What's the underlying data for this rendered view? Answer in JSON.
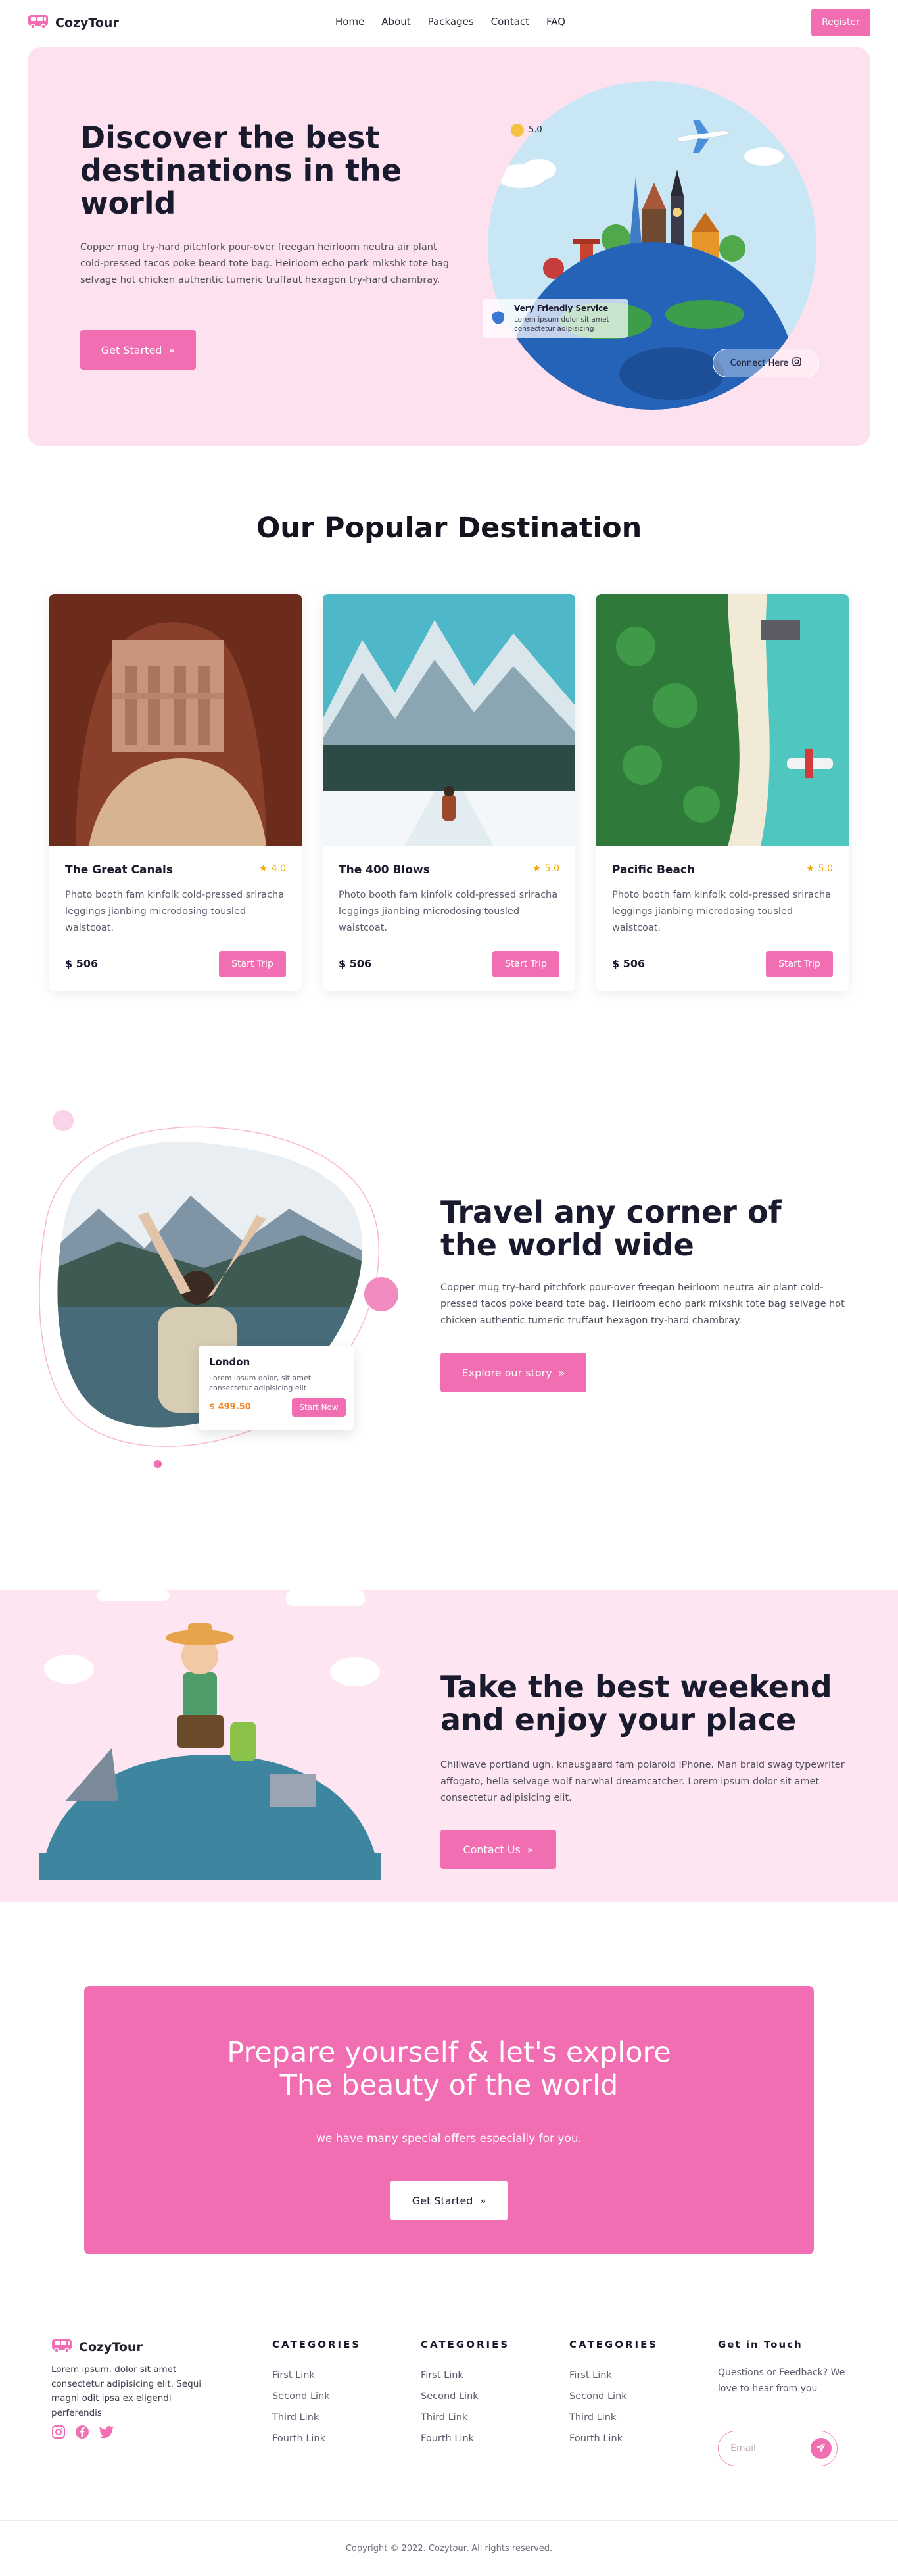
{
  "brand": {
    "name": "CozyTour",
    "accent": "#f06eb1",
    "icon": "bus-icon"
  },
  "nav": {
    "links": [
      "Home",
      "About",
      "Packages",
      "Contact",
      "FAQ"
    ],
    "register_label": "Register"
  },
  "hero": {
    "title": "Discover the best destinations in the world",
    "text": "Copper mug try-hard pitchfork pour-over freegan heirloom neutra air plant cold-pressed tacos poke beard tote bag. Heirloom echo park mlkshk tote bag selvage hot chicken authentic tumeric truffaut hexagon try-hard chambray.",
    "cta_label": "Get Started",
    "rating_value": "5.0",
    "service_title": "Very Friendly Service",
    "service_text": "Lorem ipsum dolor sit amet consectetur adipisicing",
    "connect_label": "Connect Here"
  },
  "popular": {
    "title": "Our Popular Destination",
    "cards": [
      {
        "title": "The Great Canals",
        "rating": "4.0",
        "text": "Photo booth fam kinfolk cold-pressed sriracha leggings jianbing microdosing tousled waistcoat.",
        "price": "$ 506",
        "button": "Start Trip"
      },
      {
        "title": "The 400 Blows",
        "rating": "5.0",
        "text": "Photo booth fam kinfolk cold-pressed sriracha leggings jianbing microdosing tousled waistcoat.",
        "price": "$ 506",
        "button": "Start Trip"
      },
      {
        "title": "Pacific Beach",
        "rating": "5.0",
        "text": "Photo booth fam kinfolk cold-pressed sriracha leggings jianbing microdosing tousled waistcoat.",
        "price": "$ 506",
        "button": "Start Trip"
      }
    ]
  },
  "travel": {
    "title": "Travel any corner of the world wide",
    "text": "Copper mug try-hard pitchfork pour-over freegan heirloom neutra air plant cold-pressed tacos poke beard tote bag. Heirloom echo park mlkshk tote bag selvage hot chicken authentic tumeric truffaut hexagon try-hard chambray.",
    "cta_label": "Explore our story",
    "location_card": {
      "title": "London",
      "text": "Lorem ipsum dolor, sit amet consectetur adipisicing elit",
      "price": "$ 499.50",
      "button": "Start Now"
    }
  },
  "weekend": {
    "title": "Take the best weekend and enjoy your place",
    "text": "Chillwave portland ugh, knausgaard fam polaroid iPhone. Man braid swag typewriter affogato, hella selvage wolf narwhal dreamcatcher. Lorem ipsum dolor sit amet consectetur adipisicing elit.",
    "cta_label": "Contact Us"
  },
  "promo": {
    "title_line1": "Prepare yourself & let's explore",
    "title_line2": "The beauty of the world",
    "subtitle": "we have many special offers especially for you.",
    "cta_label": "Get Started"
  },
  "footer": {
    "brand": "CozyTour",
    "about": "Lorem ipsum, dolor sit amet consectetur adipisicing elit. Sequi magni odit ipsa ex eligendi perferendis",
    "social": [
      "instagram-icon",
      "facebook-icon",
      "twitter-icon"
    ],
    "columns": [
      {
        "heading": "CATEGORIES",
        "links": [
          "First Link",
          "Second Link",
          "Third Link",
          "Fourth Link"
        ]
      },
      {
        "heading": "CATEGORIES",
        "links": [
          "First Link",
          "Second Link",
          "Third Link",
          "Fourth Link"
        ]
      },
      {
        "heading": "CATEGORIES",
        "links": [
          "First Link",
          "Second Link",
          "Third Link",
          "Fourth Link"
        ]
      }
    ],
    "contact_heading": "Get in Touch",
    "contact_text": "Questions or Feedback? We love to hear from you",
    "email_placeholder": "Email",
    "copyright": "Copyright © 2022. Cozytour. All rights reserved."
  }
}
